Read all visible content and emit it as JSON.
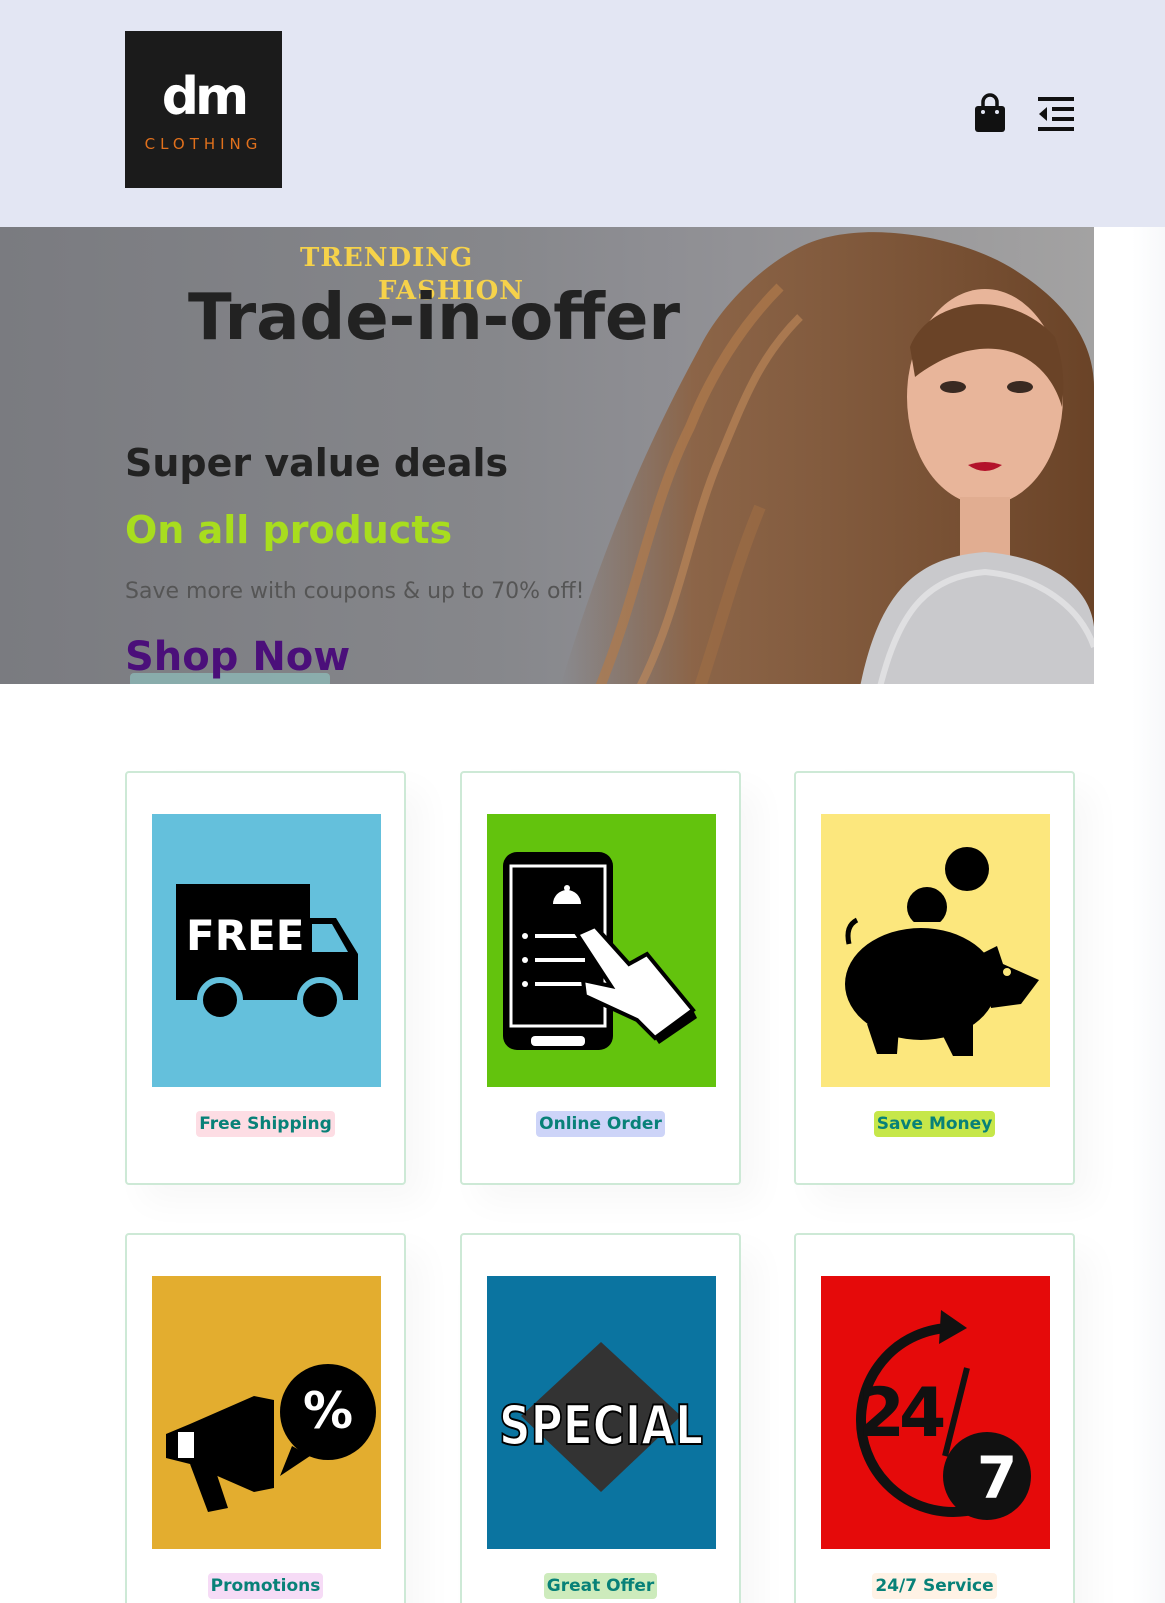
{
  "header": {
    "logo": {
      "main": "dm",
      "sub": "CLOTHING"
    },
    "icons": {
      "cart": "shopping-bag-icon",
      "menu": "menu-outdent-icon"
    }
  },
  "hero": {
    "badge_line1": "TRENDING",
    "badge_line2": "FASHION",
    "title": "Trade-in-offer",
    "heading": "Super value deals",
    "subheading": "On all products",
    "description": "Save more with coupons & up to 70% off!",
    "button_label": "Shop Now"
  },
  "features": [
    {
      "label": "Free Shipping",
      "icon": "free-shipping-truck-icon",
      "bg": "#64c0dc",
      "label_bg": "#fddde4"
    },
    {
      "label": "Online Order",
      "icon": "online-order-phone-icon",
      "bg": "#63c30d",
      "label_bg": "#cdd4f8"
    },
    {
      "label": "Save Money",
      "icon": "piggy-bank-icon",
      "bg": "#fce77d",
      "label_bg": "#d1e8f2"
    },
    {
      "label": "Promotions",
      "icon": "megaphone-percent-icon",
      "bg": "#e3ad2f",
      "label_bg": "#f6dbf6"
    },
    {
      "label": "Great Offer",
      "icon": "special-badge-icon",
      "bg": "#0b74a0",
      "label_bg": "#cdebbc"
    },
    {
      "label": "24/7 Service",
      "icon": "24-7-service-icon",
      "bg": "#e50a0a",
      "label_bg": "#fff2e5"
    }
  ]
}
